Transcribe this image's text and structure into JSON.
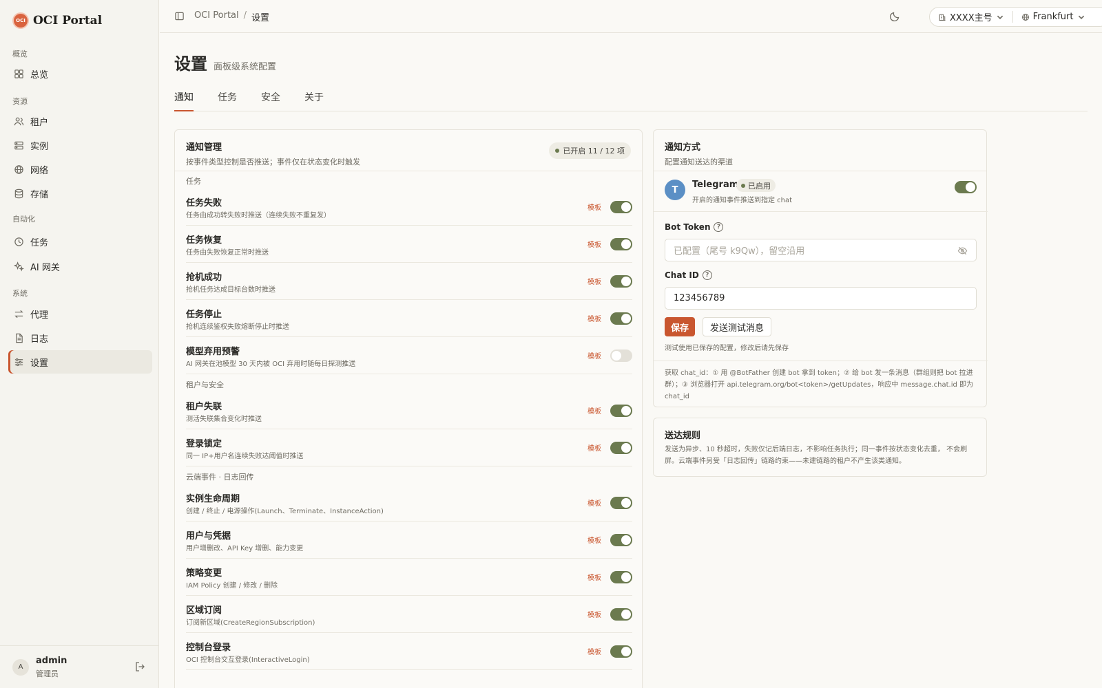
{
  "brand": {
    "name": "OCI Portal",
    "logo_text": "OCI"
  },
  "sidebar": {
    "groups": [
      {
        "label": "概览",
        "items": [
          {
            "label": "总览",
            "icon": "grid-icon"
          }
        ]
      },
      {
        "label": "资源",
        "items": [
          {
            "label": "租户",
            "icon": "users-icon"
          },
          {
            "label": "实例",
            "icon": "server-icon"
          },
          {
            "label": "网络",
            "icon": "globe-icon"
          },
          {
            "label": "存储",
            "icon": "database-icon"
          }
        ]
      },
      {
        "label": "自动化",
        "items": [
          {
            "label": "任务",
            "icon": "clock-icon"
          },
          {
            "label": "AI 网关",
            "icon": "sparkle-icon"
          }
        ]
      },
      {
        "label": "系统",
        "items": [
          {
            "label": "代理",
            "icon": "arrows-icon"
          },
          {
            "label": "日志",
            "icon": "file-icon"
          },
          {
            "label": "设置",
            "icon": "sliders-icon",
            "active": true
          }
        ]
      }
    ],
    "user": {
      "initial": "A",
      "name": "admin",
      "role": "管理员"
    }
  },
  "header": {
    "breadcrumb": [
      "OCI Portal",
      "设置"
    ],
    "separator": "/",
    "account": "XXXX主号",
    "region": "Frankfurt"
  },
  "page": {
    "title": "设置",
    "subtitle": "面板级系统配置",
    "tabs": [
      "通知",
      "任务",
      "安全",
      "关于"
    ],
    "active_tab": "通知"
  },
  "notify": {
    "title": "通知管理",
    "desc": "按事件类型控制是否推送；事件仅在状态变化时触发",
    "badge": "已开启 11 / 12 项",
    "template_label": "模板",
    "sections": [
      {
        "label": "任务",
        "rows": [
          {
            "title": "任务失败",
            "desc": "任务由成功转失败时推送（连续失败不重复发）",
            "enabled": true
          },
          {
            "title": "任务恢复",
            "desc": "任务由失败恢复正常时推送",
            "enabled": true
          },
          {
            "title": "抢机成功",
            "desc": "抢机任务达成目标台数时推送",
            "enabled": true
          },
          {
            "title": "任务停止",
            "desc": "抢机连续鉴权失败熔断停止时推送",
            "enabled": true
          },
          {
            "title": "模型弃用预警",
            "desc": "AI 网关在池模型 30 天内被 OCI 弃用时随每日探测推送",
            "enabled": false
          }
        ]
      },
      {
        "label": "租户与安全",
        "rows": [
          {
            "title": "租户失联",
            "desc": "测活失联集合变化时推送",
            "enabled": true
          },
          {
            "title": "登录锁定",
            "desc": "同一 IP+用户名连续失败达阈值时推送",
            "enabled": true
          }
        ]
      },
      {
        "label": "云端事件 · 日志回传",
        "rows": [
          {
            "title": "实例生命周期",
            "desc": "创建 / 终止 / 电源操作(Launch、Terminate、InstanceAction)",
            "enabled": true
          },
          {
            "title": "用户与凭据",
            "desc": "用户增删改、API Key 增删、能力变更",
            "enabled": true
          },
          {
            "title": "策略变更",
            "desc": "IAM Policy 创建 / 修改 / 删除",
            "enabled": true
          },
          {
            "title": "区域订阅",
            "desc": "订阅新区域(CreateRegionSubscription)",
            "enabled": true
          },
          {
            "title": "控制台登录",
            "desc": "OCI 控制台交互登录(InteractiveLogin)",
            "enabled": true
          }
        ]
      }
    ]
  },
  "channel": {
    "title": "通知方式",
    "desc": "配置通知送达的渠道",
    "telegram": {
      "initial": "T",
      "name": "Telegram",
      "badge": "已启用",
      "desc": "开启的通知事件推送到指定 chat",
      "enabled": true
    },
    "bot_token": {
      "label": "Bot Token",
      "help": "?",
      "placeholder": "已配置（尾号 k9Qw），留空沿用"
    },
    "chat_id": {
      "label": "Chat ID",
      "help": "?",
      "value": "123456789"
    },
    "save_label": "保存",
    "test_label": "发送测试消息",
    "hint": "测试使用已保存的配置，修改后请先保存",
    "help_text": "获取 chat_id：① 用 @BotFather 创建 bot 拿到 token；② 给 bot 发一条消息（群组则把 bot 拉进群）；③ 浏览器打开 api.telegram.org/bot<token>/getUpdates，响应中 message.chat.id 即为 chat_id"
  },
  "rules": {
    "title": "送达规则",
    "text": "发送为异步、10 秒超时，失败仅记后端日志，不影响任务执行；同一事件按状态变化去重， 不会刷屏。云端事件另受「日志回传」链路约束——未建链路的租户不产生该类通知。"
  },
  "colors": {
    "accent": "#c9562f",
    "toggle_on": "#6b7a4f",
    "background": "#faf9f5"
  }
}
